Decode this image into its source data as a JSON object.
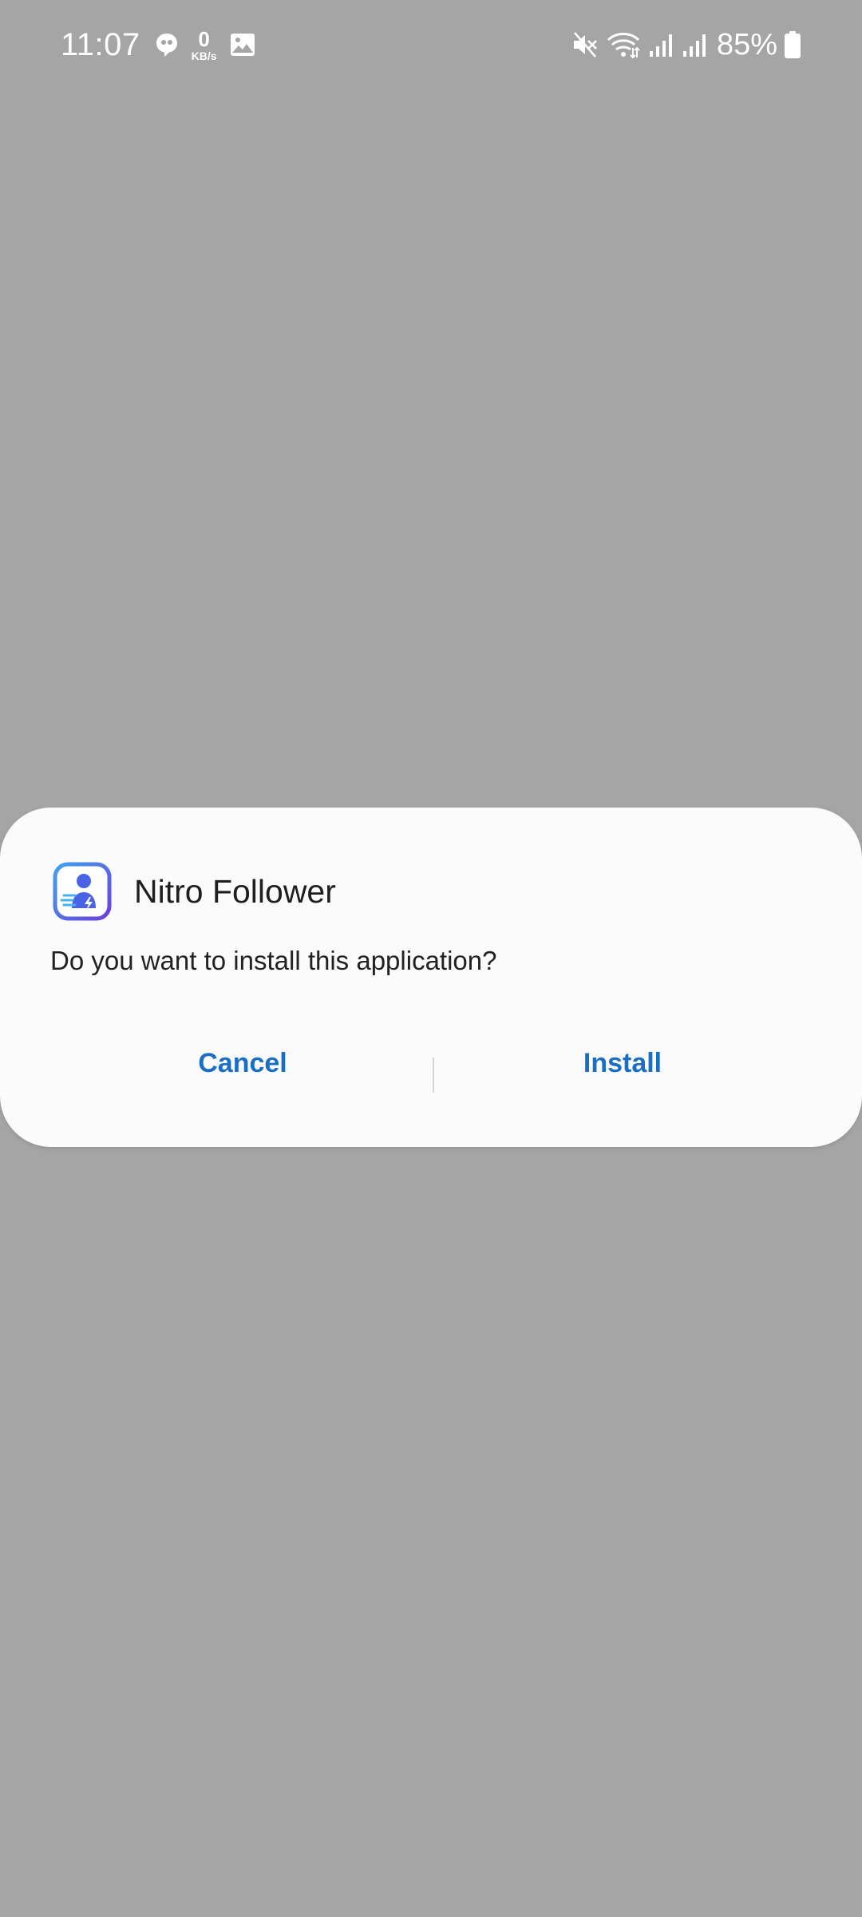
{
  "status_bar": {
    "time": "11:07",
    "net_speed_value": "0",
    "net_speed_unit": "KB/s",
    "battery_percent": "85%",
    "left_icons": [
      "chat-bubble-icon",
      "image-icon"
    ],
    "right_icons": [
      "mute-icon",
      "wifi-icon",
      "signal-icon",
      "signal-icon",
      "battery-icon"
    ]
  },
  "dialog": {
    "app_name": "Nitro Follower",
    "message": "Do you want to install this application?",
    "cancel_label": "Cancel",
    "install_label": "Install",
    "accent_color": "#1a6fc4"
  }
}
